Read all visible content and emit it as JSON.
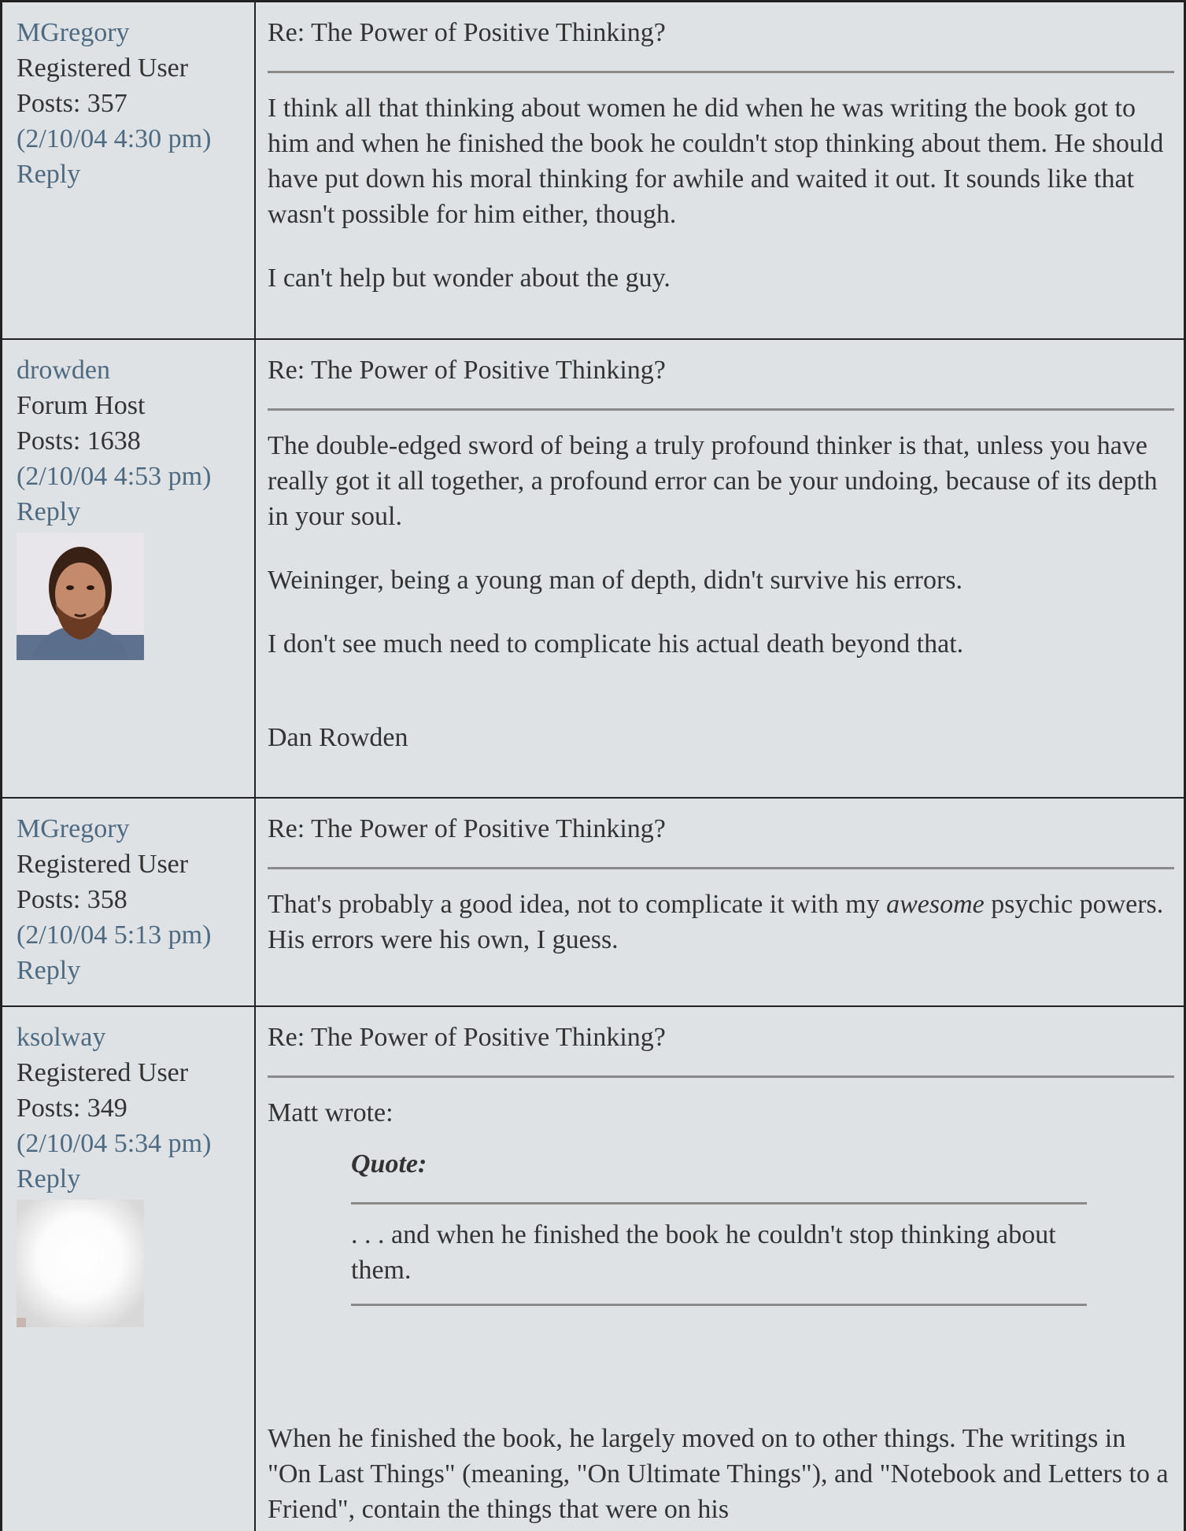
{
  "posts": [
    {
      "author": "MGregory",
      "role": "Registered User",
      "posts": "Posts: 357",
      "date": "(2/10/04 4:30 pm)",
      "reply": "Reply",
      "subject": "Re: The Power of Positive Thinking?",
      "paragraphs": [
        "I think all that thinking about women he did when he was writing the book got to him and when he finished the book he couldn't stop thinking about them. He should have put down his moral thinking for awhile and waited it out. It sounds like that wasn't possible for him either, though.",
        "I can't help but wonder about the guy."
      ]
    },
    {
      "author": "drowden",
      "role": "Forum Host",
      "posts": "Posts: 1638",
      "date": "(2/10/04 4:53 pm)",
      "reply": "Reply",
      "avatar_icon": "bearded-man-photo",
      "subject": "Re: The Power of Positive Thinking?",
      "paragraphs": [
        "The double-edged sword of being a truly profound thinker is that, unless you have really got it all together, a profound error can be your undoing, because of its depth in your soul.",
        "Weininger, being a young man of depth, didn't survive his errors.",
        "I don't see much need to complicate his actual death beyond that."
      ],
      "signature": "Dan Rowden"
    },
    {
      "author": "MGregory",
      "role": "Registered User",
      "posts": "Posts: 358",
      "date": "(2/10/04 5:13 pm)",
      "reply": "Reply",
      "subject": "Re: The Power of Positive Thinking?",
      "text_before": "That's probably a good idea, not to complicate it with my ",
      "emphasis": "awesome",
      "text_after": " psychic powers. His errors were his own, I guess."
    },
    {
      "author": "ksolway",
      "role": "Registered User",
      "posts": "Posts: 349",
      "date": "(2/10/04 5:34 pm)",
      "reply": "Reply",
      "avatar_icon": "white-glow-image",
      "subject": "Re: The Power of Positive Thinking?",
      "intro": "Matt wrote:",
      "quote_title": "Quote:",
      "quote_text": ". . . and when he finished the book he couldn't stop thinking about them.",
      "body": "When he finished the book, he largely moved on to other things. The writings in \"On Last Things\" (meaning, \"On Ultimate Things\"), and \"Notebook and Letters to a Friend\", contain the things that were on his"
    }
  ],
  "colors": {
    "background": "#dfe2e5",
    "link": "#4e6a80",
    "text": "#333333",
    "border": "#222222",
    "rule": "#8a8a8a"
  }
}
